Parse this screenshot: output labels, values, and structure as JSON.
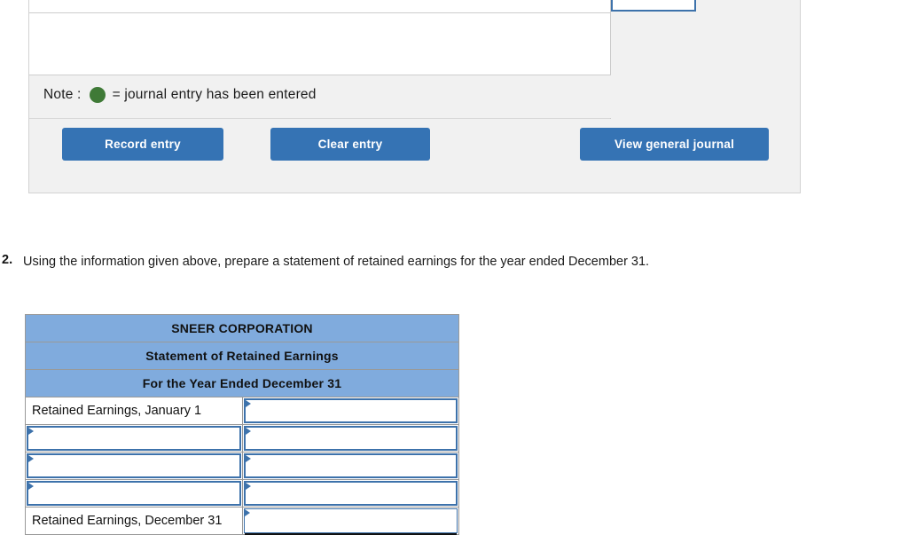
{
  "journal_panel": {
    "note": {
      "label": "Note :",
      "dot_icon": "green-circle-icon",
      "dot_color": "#3f7a37",
      "text": "= journal entry has been entered"
    },
    "buttons": {
      "record": "Record entry",
      "clear": "Clear entry",
      "view_journal": "View general journal"
    },
    "amount_inputs": [
      {
        "value": ""
      },
      {
        "value": ""
      },
      {
        "value": ""
      },
      {
        "value": ""
      },
      {
        "value": ""
      }
    ],
    "button_color": "#3573b4"
  },
  "question": {
    "number": "2.",
    "text": "Using the information given above, prepare a statement of retained earnings for the year ended December 31."
  },
  "retained_earnings_table": {
    "header_color": "#80abdd",
    "headers": [
      "SNEER CORPORATION",
      "Statement of Retained Earnings",
      "For the Year Ended December 31"
    ],
    "rows": [
      {
        "label": "Retained Earnings, January 1",
        "label_input": false,
        "amount": "",
        "total": false
      },
      {
        "label": "",
        "label_input": true,
        "amount": "",
        "total": false
      },
      {
        "label": "",
        "label_input": true,
        "amount": "",
        "total": false
      },
      {
        "label": "",
        "label_input": true,
        "amount": "",
        "total": false
      },
      {
        "label": "Retained Earnings, December 31",
        "label_input": false,
        "amount": "",
        "total": true
      }
    ]
  }
}
